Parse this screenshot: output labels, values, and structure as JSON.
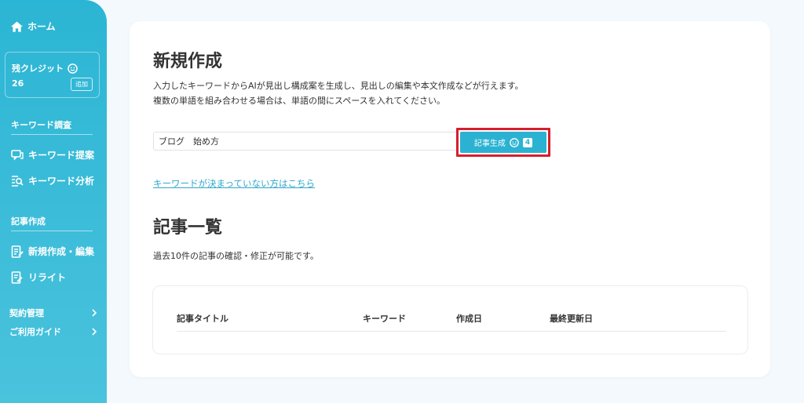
{
  "sidebar": {
    "home_label": "ホーム",
    "credit": {
      "label": "残クレジット",
      "value": "26",
      "add_label": "追加"
    },
    "keyword_section": {
      "title": "キーワード調査",
      "items": [
        {
          "label": "キーワード提案",
          "icon": "chat-icon"
        },
        {
          "label": "キーワード分析",
          "icon": "search-list-icon"
        }
      ]
    },
    "article_section": {
      "title": "記事作成",
      "items": [
        {
          "label": "新規作成・編集",
          "icon": "edit-doc-icon"
        },
        {
          "label": "リライト",
          "icon": "rewrite-icon"
        }
      ]
    },
    "links": [
      {
        "label": "契約管理"
      },
      {
        "label": "ご利用ガイド"
      }
    ],
    "colors": {
      "accent": "#2bb5d4"
    }
  },
  "new_article": {
    "title": "新規作成",
    "desc_line1": "入力したキーワードからAIが見出し構成案を生成し、見出しの編集や本文作成などが行えます。",
    "desc_line2": "複数の単語を組み合わせる場合は、単語の間にスペースを入れてください。",
    "keyword_value": "ブログ　始め方",
    "generate_label": "記事生成",
    "generate_count": "4",
    "help_link": "キーワードが決まっていない方はこちら"
  },
  "article_list": {
    "title": "記事一覧",
    "desc": "過去10件の記事の確認・修正が可能です。",
    "columns": [
      "記事タイトル",
      "キーワード",
      "作成日",
      "最終更新日"
    ]
  }
}
